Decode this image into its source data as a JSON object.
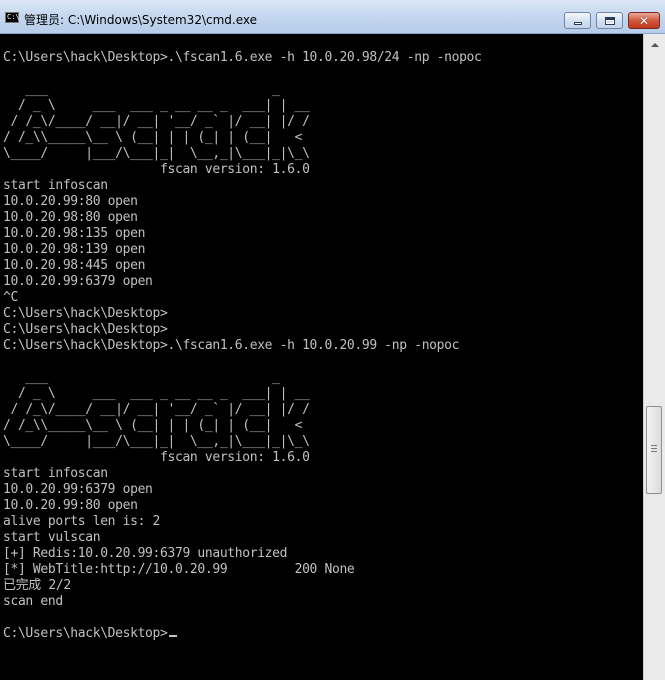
{
  "window": {
    "title": "管理员: C:\\Windows\\System32\\cmd.exe",
    "icon": "cmd-icon",
    "buttons": {
      "minimize": "minimize-icon",
      "maximize": "maximize-icon",
      "close": "close-icon"
    }
  },
  "colors": {
    "console_bg": "#000000",
    "console_fg": "#c0c0c0",
    "titlebar": "#c2d6ef",
    "close_button": "#c1371c"
  },
  "console": {
    "lines": [
      "",
      "C:\\Users\\hack\\Desktop>.\\fscan1.6.exe -h 10.0.20.98/24 -np -nopoc",
      "",
      "   ___                              _",
      "  / _ \\     ___  ___ _ __ __ _  ___| | __",
      " / /_\\/____/ __|/ __| '__/ _` |/ __| |/ /",
      "/ /_\\\\_____\\__ \\ (__| | | (_| | (__|   <",
      "\\____/     |___/\\___|_|  \\__,_|\\___|_|\\_\\",
      "                     fscan version: 1.6.0",
      "start infoscan",
      "10.0.20.99:80 open",
      "10.0.20.98:80 open",
      "10.0.20.98:135 open",
      "10.0.20.98:139 open",
      "10.0.20.98:445 open",
      "10.0.20.99:6379 open",
      "^C",
      "C:\\Users\\hack\\Desktop>",
      "C:\\Users\\hack\\Desktop>",
      "C:\\Users\\hack\\Desktop>.\\fscan1.6.exe -h 10.0.20.99 -np -nopoc",
      "",
      "",
      "   ___                              _",
      "  / _ \\     ___  ___ _ __ __ _  ___| | __",
      " / /_\\/____/ __|/ __| '__/ _` |/ __| |/ /",
      "/ /_\\\\_____\\__ \\ (__| | | (_| | (__|   <",
      "\\____/     |___/\\___|_|  \\__,_|\\___|_|\\_\\",
      "                     fscan version: 1.6.0",
      "start infoscan",
      "10.0.20.99:6379 open",
      "10.0.20.99:80 open",
      "alive ports len is: 2",
      "start vulscan",
      "[+] Redis:10.0.20.99:6379 unauthorized",
      "[*] WebTitle:http://10.0.20.99         200 None",
      "已完成 2/2",
      "scan end",
      "",
      "C:\\Users\\hack\\Desktop>"
    ]
  },
  "scrollbar": {
    "up_icon": "scroll-up-arrow-icon",
    "position_fraction": 0.62
  }
}
